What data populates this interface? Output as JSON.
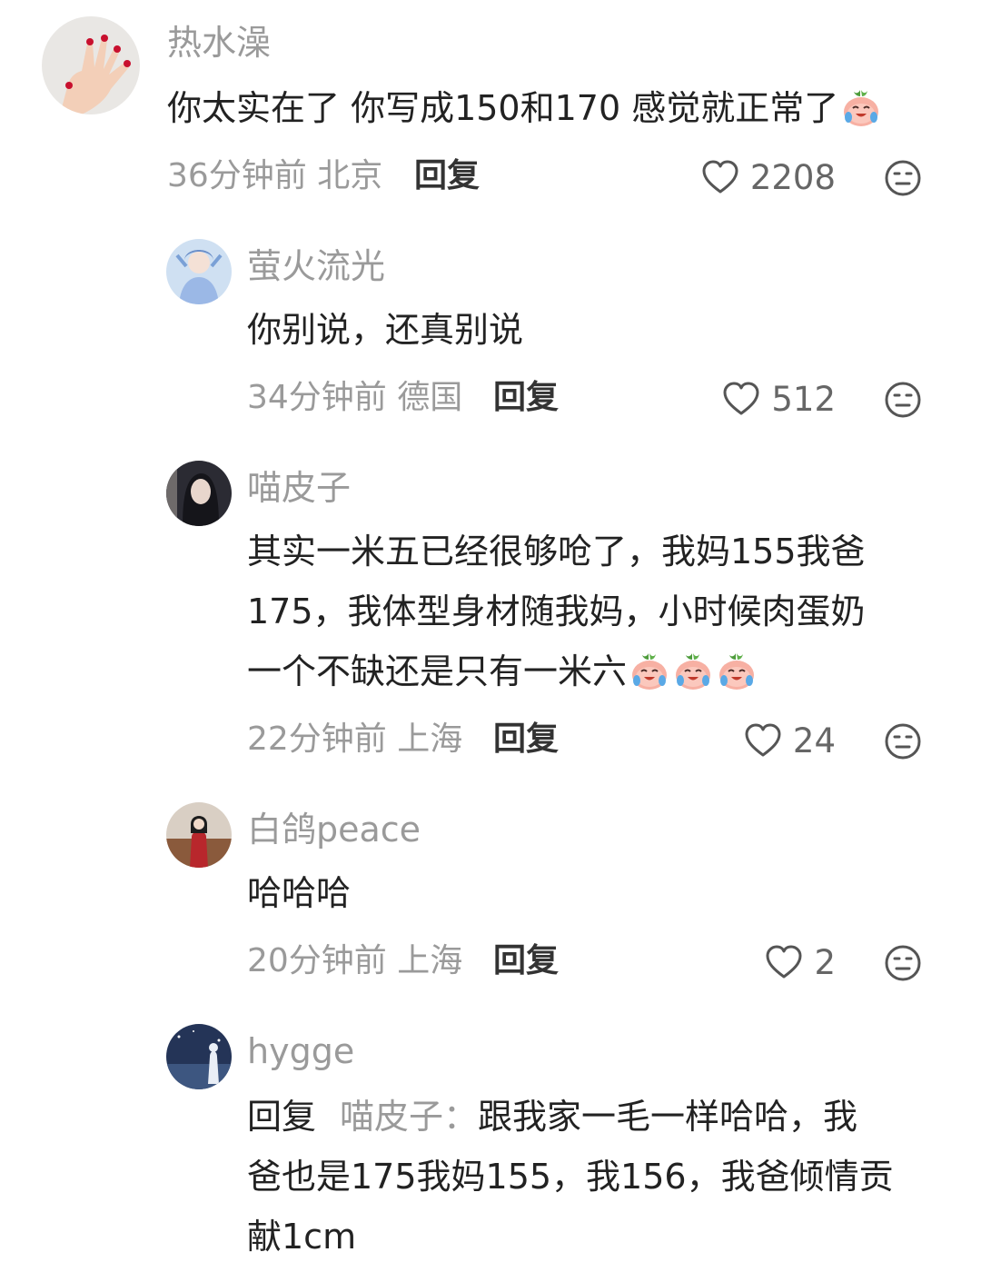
{
  "comments": [
    {
      "username": "热水澡",
      "text": "你太实在了 你写成150和170 感觉就正常了",
      "emoji": "crying-peach-emoji",
      "time": "36分钟前",
      "location": "北京",
      "reply_label": "回复",
      "likes": "2208",
      "avatar": "hand-red-nails"
    },
    {
      "username": "萤火流光",
      "text": "你别说，还真别说",
      "time": "34分钟前",
      "location": "德国",
      "reply_label": "回复",
      "likes": "512",
      "avatar": "anime-girl-blue"
    },
    {
      "username": "喵皮子",
      "text_lines": [
        "其实一米五已经很够呛了，我妈155我爸",
        "175，我体型身材随我妈，小时候肉蛋奶",
        "一个不缺还是只有一米六"
      ],
      "emoji": "crying-peach-emoji",
      "time": "22分钟前",
      "location": "上海",
      "reply_label": "回复",
      "likes": "24",
      "avatar": "woman-dark"
    },
    {
      "username": "白鸽peace",
      "text": "哈哈哈",
      "time": "20分钟前",
      "location": "上海",
      "reply_label": "回复",
      "likes": "2",
      "avatar": "girl-red-coat"
    },
    {
      "username": "hygge",
      "reply_prefix": "回复",
      "reply_target": "喵皮子：",
      "text_lines": [
        "跟我家一毛一样哈哈，我",
        "爸也是175我妈155，我156，我爸倾情贡",
        "献1cm"
      ],
      "avatar": "night-sky-figure"
    }
  ],
  "icons": {
    "like": "heart-outline-icon",
    "dislike": "dislike-face-icon"
  },
  "colors": {
    "username": "#9a9a9a",
    "text": "#222222",
    "meta": "#9a9a9a",
    "reply": "#333333"
  }
}
